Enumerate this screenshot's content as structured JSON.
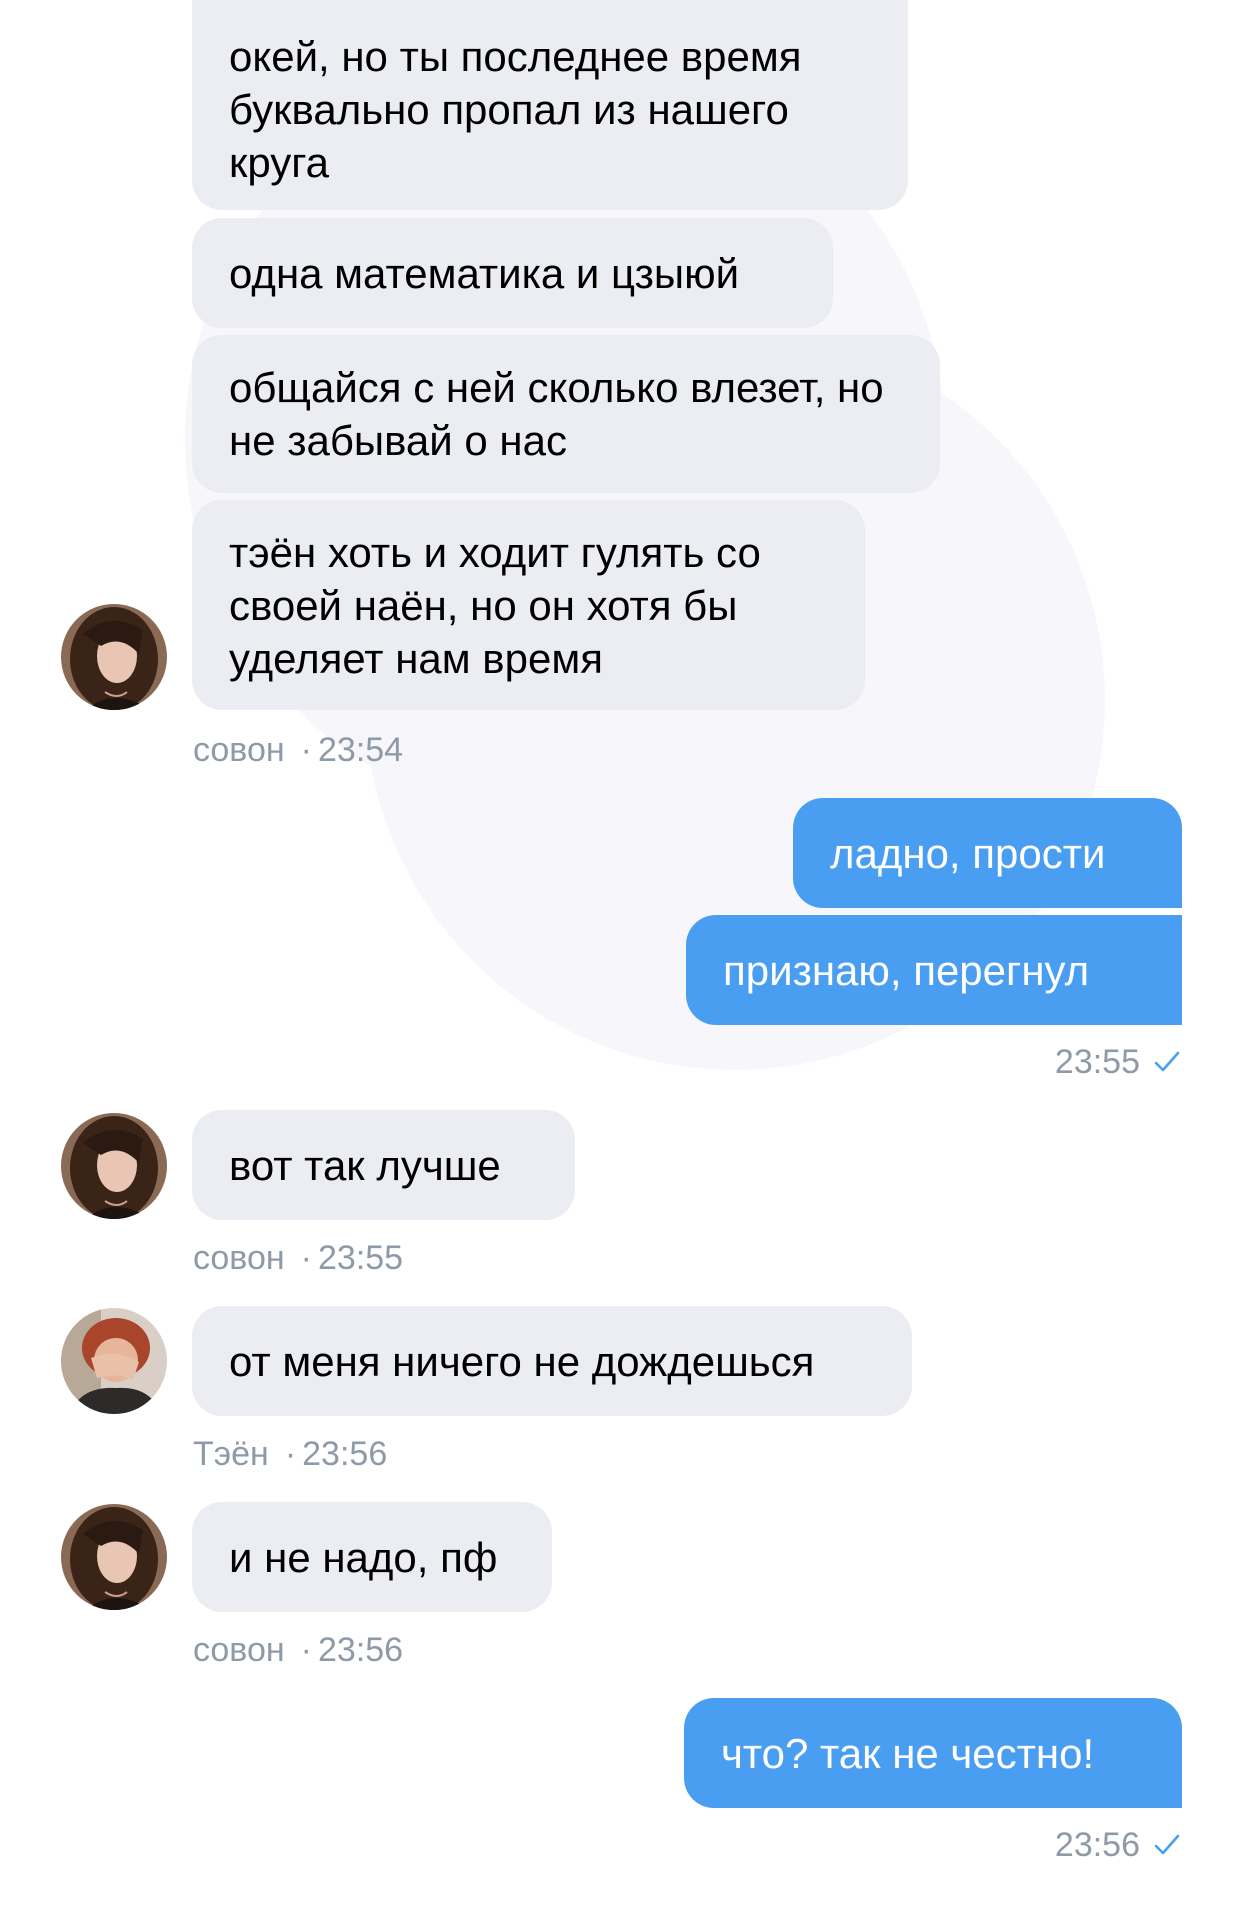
{
  "colors": {
    "incoming_bubble": "#ebedf2",
    "outgoing_bubble": "#4a9ef2",
    "meta_text": "#8e9aa8",
    "read_check": "#4a9ef2"
  },
  "messages": [
    {
      "direction": "in",
      "text": "окей, но ты последнее время буквально пропал из нашего круга"
    },
    {
      "direction": "in",
      "text": "одна математика и цзыюй"
    },
    {
      "direction": "in",
      "text": "общайся с ней сколько влезет, но не забывай о нас"
    },
    {
      "direction": "in",
      "text": "тэён хоть и ходит гулять со своей наён, но он хотя бы уделяет нам время"
    },
    {
      "direction": "out",
      "text": "ладно, прости"
    },
    {
      "direction": "out",
      "text": "признаю, перегнул"
    },
    {
      "direction": "in",
      "text": "вот так лучше"
    },
    {
      "direction": "in",
      "text": "от меня ничего не дождешься"
    },
    {
      "direction": "in",
      "text": "и не надо, пф"
    },
    {
      "direction": "out",
      "text": "что? так не честно!"
    }
  ],
  "meta": [
    {
      "sender": "совон",
      "sep": "·",
      "time": "23:54"
    },
    {
      "time": "23:55",
      "status_icon": "read-check-icon"
    },
    {
      "sender": "совон",
      "sep": "·",
      "time": "23:55"
    },
    {
      "sender": "Тэён",
      "sep": "·",
      "time": "23:56"
    },
    {
      "sender": "совон",
      "sep": "·",
      "time": "23:56"
    },
    {
      "time": "23:56",
      "status_icon": "read-check-icon"
    }
  ],
  "avatars": [
    {
      "icon": "avatar-sowon"
    },
    {
      "icon": "avatar-sowon"
    },
    {
      "icon": "avatar-taeyeon"
    },
    {
      "icon": "avatar-sowon"
    }
  ]
}
